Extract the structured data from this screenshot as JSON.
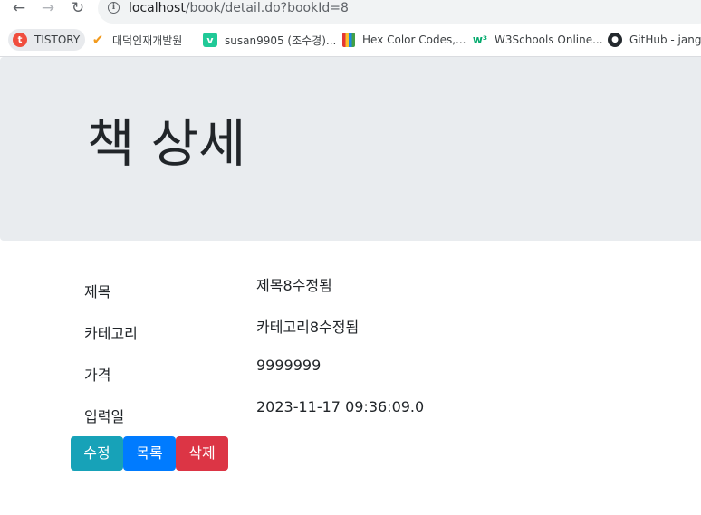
{
  "browser": {
    "url_host": "localhost",
    "url_path": "/book/detail.do?bookId=8",
    "bookmarks": [
      {
        "label": "TISTORY",
        "icon": "tistory-icon"
      },
      {
        "label": "대덕인재개발원",
        "icon": "flame-icon"
      },
      {
        "label": "susan9905 (조수경)...",
        "icon": "velog-icon"
      },
      {
        "label": "Hex Color Codes,...",
        "icon": "books-icon"
      },
      {
        "label": "W3Schools Online...",
        "icon": "w3schools-icon"
      },
      {
        "label": "GitHub - jangn",
        "icon": "github-icon"
      }
    ]
  },
  "page": {
    "title": "책 상세"
  },
  "detail": {
    "rows": [
      {
        "label": "제목",
        "value": "제목8수정됨"
      },
      {
        "label": "카테고리",
        "value": "카테고리8수정됨"
      },
      {
        "label": "가격",
        "value": "9999999"
      },
      {
        "label": "입력일",
        "value": "2023-11-17 09:36:09.0"
      }
    ]
  },
  "actions": {
    "edit_label": "수정",
    "list_label": "목록",
    "delete_label": "삭제",
    "colors": {
      "edit": "#17a2b8",
      "list": "#007bff",
      "delete": "#dc3545"
    }
  }
}
